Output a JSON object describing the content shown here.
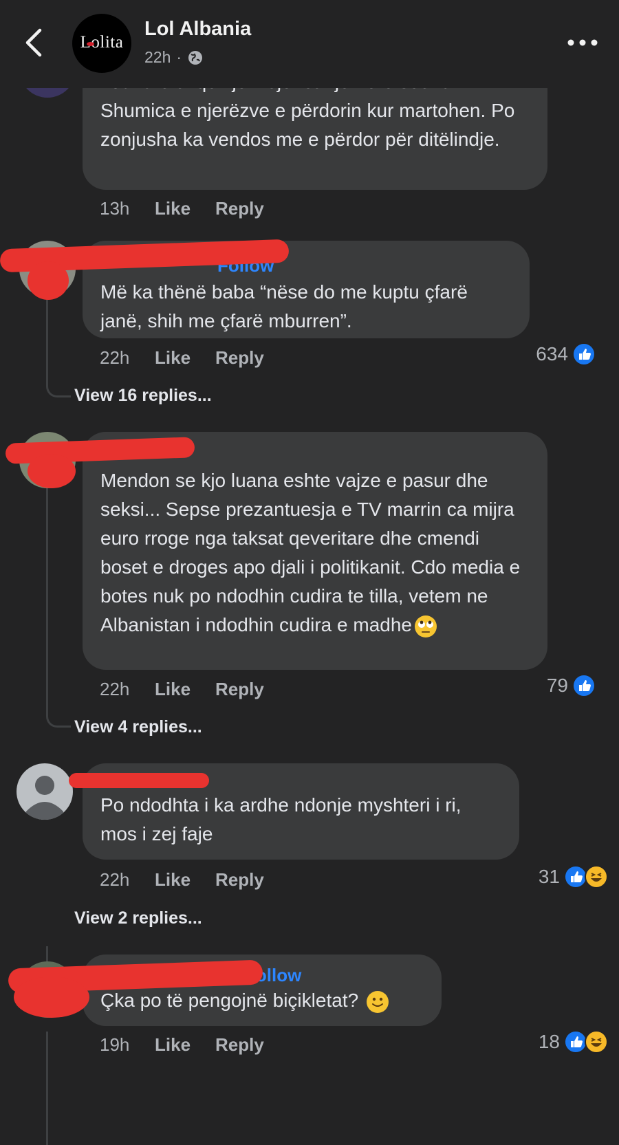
{
  "header": {
    "page_name": "Lol Albania",
    "time": "22h",
    "separator": "·",
    "logo_text": "Lolita",
    "icons": [
      "back-chevron-icon",
      "globe-icon",
      "more-dots-icon"
    ]
  },
  "comments": [
    {
      "text": "Luana e di që kjo i lejohet një herë secilit. Shumica e njerëzve e përdorin kur martohen. Po zonjusha ka vendos me e përdor për ditëlindje.",
      "partial_first_line": "Luana e di që kjo i lejohet një herë secilit.",
      "rest": "Shumica e njerëzve e përdorin kur martohen. Po zonjusha ka vendos me e përdor për ditëlindje.",
      "time": "13h",
      "like": "Like",
      "reply": "Reply"
    },
    {
      "follow": "Follow",
      "text": "Më ka thënë baba “nëse do me kuptu çfarë janë, shih me çfarë mburren”.",
      "time": "22h",
      "like": "Like",
      "reply": "Reply",
      "reaction_count": "634",
      "view_replies": "View 16 replies..."
    },
    {
      "text": "Mendon se kjo luana eshte vajze e pasur dhe seksi... Sepse prezantuesja e TV marrin ca mijra euro rroge nga taksat qeveritare dhe cmendi boset e droges apo djali i politikanit. Cdo media e botes nuk po ndodhin cudira te tilla, vetem ne Albanistan i ndodhin cudira e madhe",
      "emoji": "rolling-eyes-emoji",
      "time": "22h",
      "like": "Like",
      "reply": "Reply",
      "reaction_count": "79",
      "view_replies": "View 4 replies..."
    },
    {
      "text": "Po ndodhta i ka ardhe ndonje myshteri i ri, mos i zej faje",
      "time": "22h",
      "like": "Like",
      "reply": "Reply",
      "reaction_count": "31",
      "view_replies": "View 2 replies..."
    },
    {
      "follow": "Follow",
      "text": "Çka po të pengojnë biçikletat?",
      "emoji": "slightly-smiling-emoji",
      "time": "19h",
      "like": "Like",
      "reply": "Reply",
      "reaction_count": "18"
    }
  ],
  "colors": {
    "background": "#232324",
    "bubble": "#3a3b3c",
    "follow": "#2d86ff",
    "like_reaction": "#1877f2",
    "haha_reaction": "#f7b928",
    "redaction": "#e8332f"
  }
}
